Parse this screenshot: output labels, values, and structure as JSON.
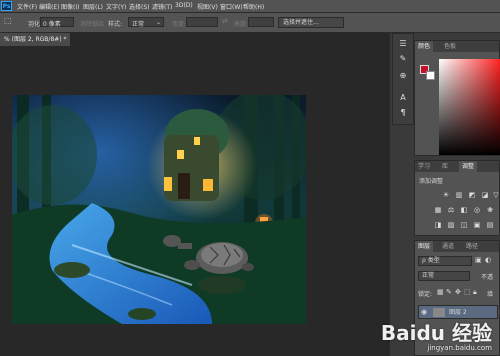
{
  "app": {
    "logo": "Ps"
  },
  "menu": [
    "文件(F)",
    "编辑(E)",
    "图像(I)",
    "图层(L)",
    "文字(Y)",
    "选择(S)",
    "滤镜(T)",
    "3D(D)",
    "视图(V)",
    "窗口(W)",
    "帮助(H)"
  ],
  "options": {
    "feather_label": "羽化:",
    "feather_value": "0 像素",
    "antialias_label": "消除锯齿",
    "style_label": "样式:",
    "style_value": "正常",
    "width_label": "宽度:",
    "height_label": "高度:",
    "select_subject": "选择并遮住..."
  },
  "document_tab": {
    "label": "% (图层 2, RGB/8#) *"
  },
  "panels": {
    "color_tabs": [
      "颜色",
      "色板"
    ],
    "adjust_tabs": [
      "学习",
      "库",
      "调整"
    ],
    "adjust_title": "添加调整",
    "layers_tabs": [
      "图层",
      "通道",
      "路径"
    ],
    "layer_kind": "ρ 类型",
    "blend_mode": "正常",
    "opacity_short": "不透",
    "lock_label": "锁定:",
    "fill_short": "填",
    "layer_name": "图层 2"
  },
  "watermark": {
    "logo": "Baidu 经验",
    "url": "jingyan.baidu.com"
  },
  "colors": {
    "foreground": "#c8102e",
    "background": "#ffffff",
    "accent": "#31a8ff"
  }
}
